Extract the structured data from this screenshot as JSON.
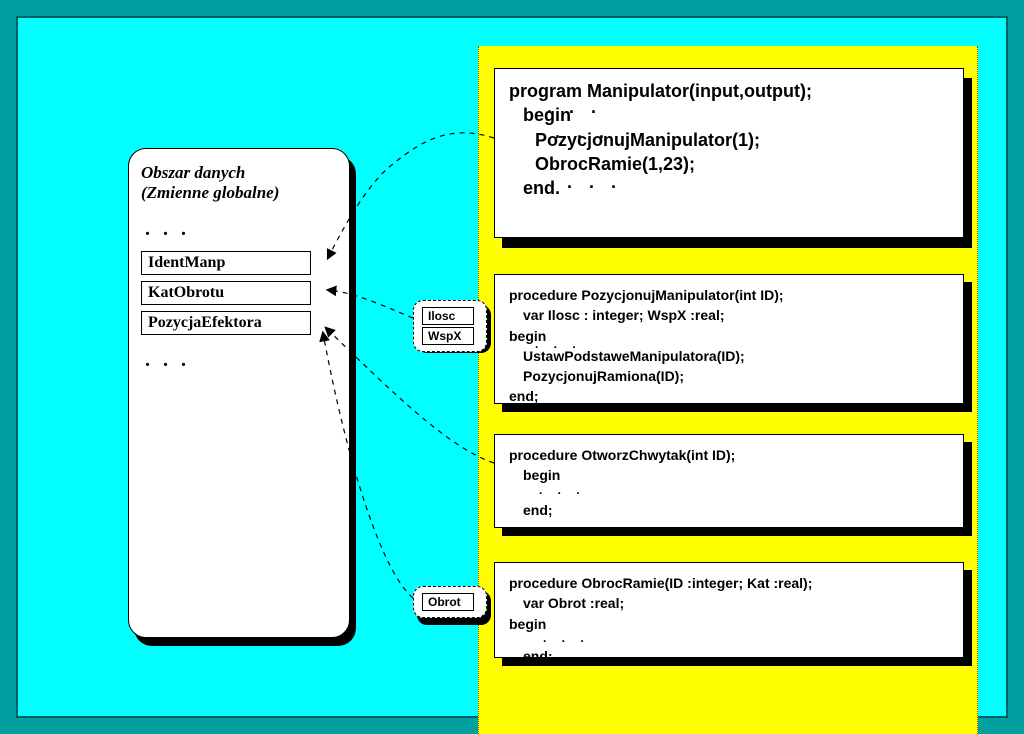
{
  "data_area": {
    "title": "Obszar danych\n(Zmienne globalne)",
    "vars": [
      "IdentManp",
      "KatObrotu",
      "PozycjaEfektora"
    ]
  },
  "main_block": {
    "l1": "program Manipulator(input,output);",
    "l2": "begin",
    "l3": "PozycjonujManipulator(1);",
    "l4": "ObrocRamie(1,23);",
    "l5": "end."
  },
  "proc1": {
    "l1": "procedure PozycjonujManipulator(int ID);",
    "l2": "var Ilosc : integer;  WspX :real;",
    "l3": "begin",
    "l4": "UstawPodstaweManipulatora(ID);",
    "l5": "PozycjonujRamiona(ID);",
    "l6": "end;",
    "locals": [
      "Ilosc",
      "WspX"
    ]
  },
  "proc2": {
    "l1": "procedure OtworzChwytak(int ID);",
    "l2": "begin",
    "l3": "end;"
  },
  "proc3": {
    "l1": "procedure ObrocRamie(ID :integer; Kat :real);",
    "l2": "var Obrot :real;",
    "l3": "begin",
    "l4": "end;",
    "locals": [
      "Obrot"
    ]
  },
  "dots": ". . ."
}
